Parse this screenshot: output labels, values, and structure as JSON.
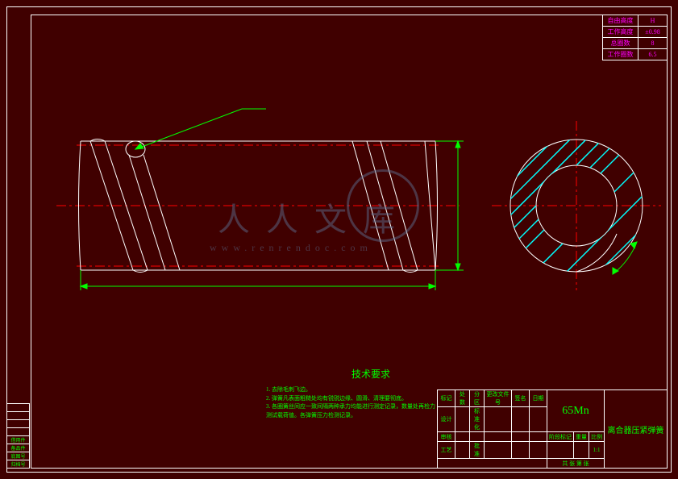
{
  "info_table": {
    "rows": [
      {
        "label": "自由高度",
        "value": "H"
      },
      {
        "label": "工作高度",
        "value": "±0.98"
      },
      {
        "label": "总圈数",
        "value": "8"
      },
      {
        "label": "工作圈数",
        "value": "6.5"
      }
    ]
  },
  "tech_requirements": {
    "title": "技术要求",
    "lines": [
      "1. 去除毛刺飞边。",
      "2. 弹簧凡表面粗糙处均有锐锐边缘、圆滑、清理要彻底。",
      "3. 各圈簧丝间应一致间隔两种承力均能进行测定记录，数量处再检力",
      "测试载荷值。各弹簧压力检测记录。"
    ]
  },
  "title_block": {
    "material": "65Mn",
    "part_name": "离合器压紧弹簧",
    "headers": [
      "标记",
      "处数",
      "分区",
      "更改文件号",
      "签名",
      "日期"
    ],
    "row2": [
      "设计",
      "",
      "标准化",
      "",
      "",
      ""
    ],
    "row3": [
      "审核",
      "",
      "",
      "",
      "",
      ""
    ],
    "row4": [
      "工艺",
      "",
      "批准",
      "",
      "",
      ""
    ],
    "scale_label": "比例",
    "scale_value": "1:1",
    "weight_label": "重量",
    "weight_value": "",
    "sheet_label": "共  张 第  张",
    "stage_label": "阶段标记",
    "drawing_no": ""
  },
  "rev_block": {
    "rows": [
      [
        "",
        ""
      ],
      [
        "",
        ""
      ],
      [
        "",
        ""
      ],
      [
        "",
        ""
      ],
      [
        "借用件",
        ""
      ],
      [
        "备品件",
        ""
      ],
      [
        "底图号",
        ""
      ],
      [
        "归档号",
        ""
      ]
    ]
  },
  "watermark": {
    "main": "人人文库",
    "url": "www.renrendoc.com"
  },
  "chart_data": {
    "type": "engineering_drawing",
    "part": "compression spring (离合器压紧弹簧)",
    "material": "65Mn",
    "views": [
      "side section view",
      "end view (axial)"
    ],
    "parameters": {
      "free_height": "H",
      "working_height_tolerance": "±0.98",
      "total_coils": 8,
      "active_coils": 6.5
    },
    "annotations": [
      "outer diameter dimension",
      "free length dimension",
      "wire diameter callout",
      "end coil detail"
    ],
    "colors": {
      "outline": "#ffffff",
      "centerline": "#ff0000",
      "dimensions": "#00ff00",
      "section_hatch": "#00ffff",
      "text": "#00ff00"
    }
  }
}
